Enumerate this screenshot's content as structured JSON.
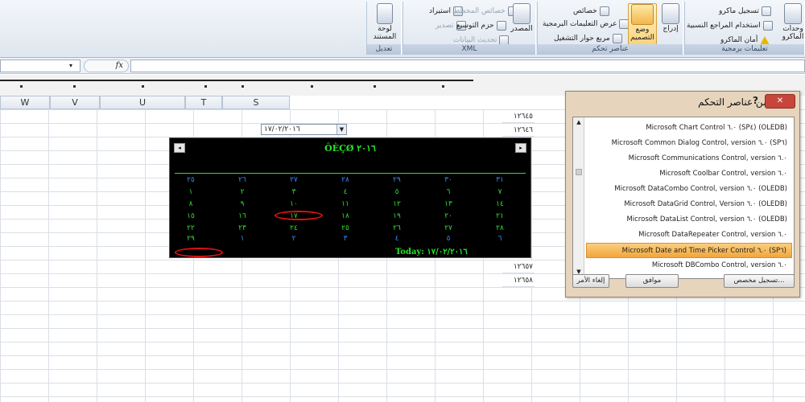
{
  "ribbon": {
    "groups": {
      "code_label": "تعليمات برمجية",
      "controls_label": "عناصر تحكم",
      "xml_label": "XML",
      "modify_label": "تعديل"
    },
    "code": {
      "record_macro": "تسجيل ماكرو",
      "relative_refs": "استخدام المراجع النسبية",
      "macro_security": "أمان الماكرو",
      "macros_big": "وحدات الماكرو"
    },
    "controls": {
      "properties": "خصائص",
      "view_code": "عرض التعليمات البرمجية",
      "run_dialog": "مربع حوار التشغيل",
      "design_mode": "وضع التصميم",
      "insert": "إدراج"
    },
    "xml": {
      "source": "المصدر",
      "map_properties": "خصائص المخطط",
      "expansion_packs": "حزم التوسيع",
      "refresh_data": "تحديث البيانات",
      "import": "استيراد",
      "export": "تصدير"
    },
    "modify": {
      "document_panel": "لوحة المستند"
    }
  },
  "formula_bar": {
    "fx": "fx",
    "name_arrow": "▾"
  },
  "columns": [
    "W",
    "V",
    "U",
    "T",
    "S"
  ],
  "cells": {
    "r1": "١٢٦٤٥",
    "r2": "١٢٦٤٦",
    "r3": "١٢٦٥٧",
    "r4": "١٢٦٥٨"
  },
  "date_picker": {
    "value": "١٧/٠٢/٢٠١٦",
    "arrow": "▼"
  },
  "calendar": {
    "title": "ÔÈÇØ ٢٠١٦",
    "prev": "◂",
    "next": "▸",
    "today_label": "Today: ١٧/٠٢/٢٠١٦",
    "weeks": [
      [
        "٢٥",
        "٢٦",
        "٢٧",
        "٢٨",
        "٢٩",
        "٣٠",
        "٣١"
      ],
      [
        "١",
        "٢",
        "٣",
        "٤",
        "٥",
        "٦",
        "٧"
      ],
      [
        "٨",
        "٩",
        "١٠",
        "١١",
        "١٢",
        "١٣",
        "١٤"
      ],
      [
        "١٥",
        "١٦",
        "١٧",
        "١٨",
        "١٩",
        "٢٠",
        "٢١"
      ],
      [
        "٢٢",
        "٢٣",
        "٢٤",
        "٢٥",
        "٢٦",
        "٢٧",
        "٢٨"
      ],
      [
        "٢٩",
        "١",
        "٢",
        "٣",
        "٤",
        "٥",
        "٦"
      ]
    ]
  },
  "dialog": {
    "title": "مزيد من عناصر التحكم",
    "help": "?",
    "close": "✕",
    "items": [
      "Microsoft Chart Control ٦.٠ (SP٤) (OLEDB)",
      "Microsoft Common Dialog Control, version ٦.٠ (SP٦)",
      "Microsoft Communications Control, version ٦.٠",
      "Microsoft Coolbar Control, version ٦.٠",
      "Microsoft DataCombo Control, version ٦.٠ (OLEDB)",
      "Microsoft DataGrid Control, Version ٦.٠ (OLEDB)",
      "Microsoft DataList Control, version ٦.٠ (OLEDB)",
      "Microsoft DataRepeater Control, version ٦.٠",
      "Microsoft Date and Time Picker Control ٦.٠ (SP٦)",
      "Microsoft DBCombo Control, version ٦.٠"
    ],
    "selected_index": 8,
    "register_custom": "تسجيل مخصص...",
    "ok": "موافق",
    "cancel": "إلغاء الأمر"
  }
}
